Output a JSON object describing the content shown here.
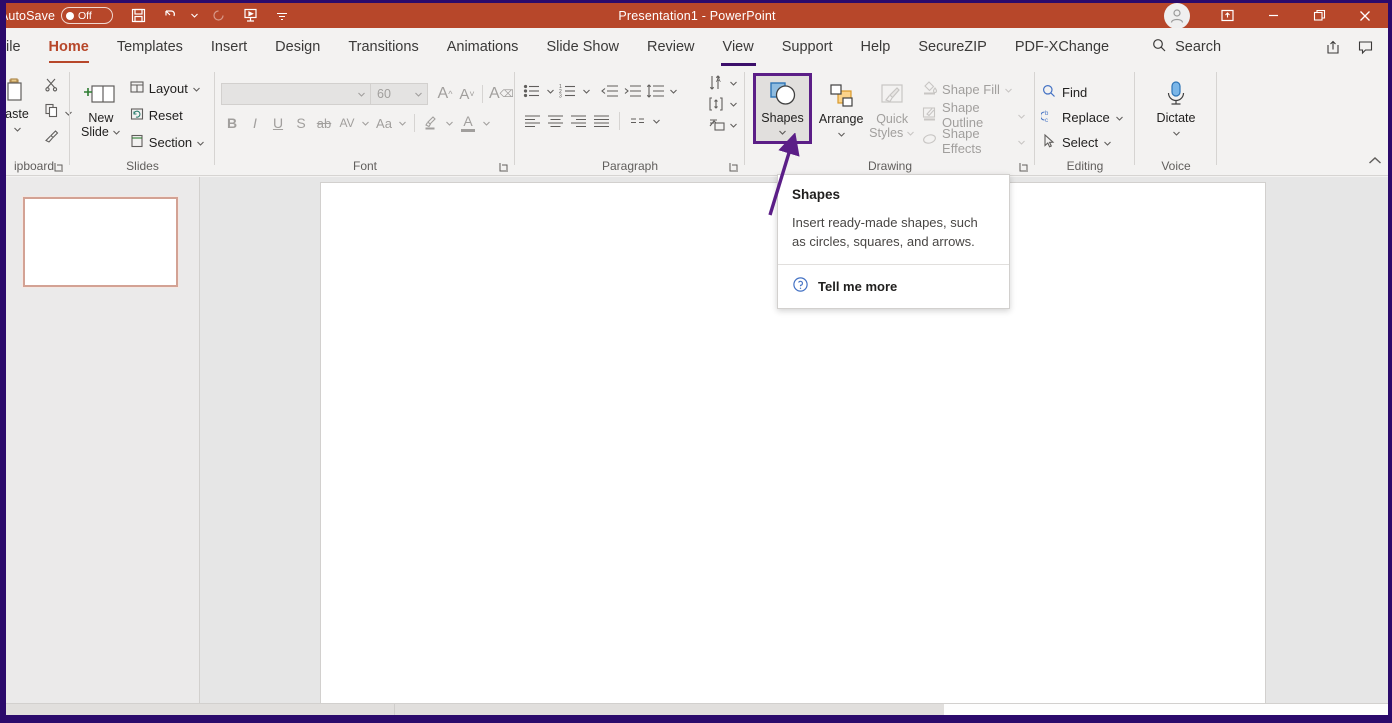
{
  "titlebar": {
    "autosave_label": "AutoSave",
    "autosave_state": "Off",
    "document_title": "Presentation1  -  PowerPoint",
    "quick_access": [
      {
        "name": "save-icon",
        "label": "Save"
      },
      {
        "name": "undo-icon",
        "label": "Undo"
      },
      {
        "name": "undo-dropdown-icon",
        "label": "Undo options"
      },
      {
        "name": "redo-icon",
        "label": "Redo"
      },
      {
        "name": "start-from-beginning-icon",
        "label": "Start From Beginning"
      },
      {
        "name": "customize-qat-icon",
        "label": "Customize Quick Access Toolbar"
      }
    ],
    "window_controls": [
      {
        "name": "ribbon-display-options-icon",
        "label": "Ribbon Display Options"
      },
      {
        "name": "minimize-icon",
        "label": "Minimize"
      },
      {
        "name": "restore-icon",
        "label": "Restore Down"
      },
      {
        "name": "close-icon",
        "label": "Close"
      }
    ],
    "accent_color": "#b7472a"
  },
  "tabs": [
    {
      "label": "ile",
      "name": "tab-file",
      "active": false
    },
    {
      "label": "Home",
      "name": "tab-home",
      "active": true
    },
    {
      "label": "Templates",
      "name": "tab-templates",
      "active": false
    },
    {
      "label": "Insert",
      "name": "tab-insert",
      "active": false
    },
    {
      "label": "Design",
      "name": "tab-design",
      "active": false
    },
    {
      "label": "Transitions",
      "name": "tab-transitions",
      "active": false
    },
    {
      "label": "Animations",
      "name": "tab-animations",
      "active": false
    },
    {
      "label": "Slide Show",
      "name": "tab-slide-show",
      "active": false
    },
    {
      "label": "Review",
      "name": "tab-review",
      "active": false
    },
    {
      "label": "View",
      "name": "tab-view",
      "active": false
    },
    {
      "label": "Support",
      "name": "tab-support",
      "active": false
    },
    {
      "label": "Help",
      "name": "tab-help",
      "active": false
    },
    {
      "label": "SecureZIP",
      "name": "tab-securezip",
      "active": false
    },
    {
      "label": "PDF-XChange",
      "name": "tab-pdf-xchange",
      "active": false
    }
  ],
  "search": {
    "label": "Search"
  },
  "ribbon": {
    "clipboard": {
      "group_label": "ipboard",
      "paste_label": "aste",
      "cut_label": "Cut",
      "copy_label": "Copy",
      "format_painter_label": "Format Painter"
    },
    "slides": {
      "group_label": "Slides",
      "new_slide_line1": "New",
      "new_slide_line2": "Slide",
      "layout_label": "Layout",
      "reset_label": "Reset",
      "section_label": "Section"
    },
    "font": {
      "group_label": "Font",
      "font_name_value": "",
      "font_size_value": "60",
      "increase_size_label": "A",
      "decrease_size_label": "A",
      "clear_formatting_label": "A",
      "bold_label": "B",
      "italic_label": "I",
      "underline_label": "U",
      "shadow_label": "S",
      "strikethrough_label": "ab",
      "char_spacing_label": "AV",
      "change_case_label": "Aa",
      "text_highlight_label": "Text Highlight Color",
      "font_color_label": "A",
      "disabled": true
    },
    "paragraph": {
      "group_label": "Paragraph",
      "buttons": [
        "Bullets",
        "Numbering",
        "Decrease Indent",
        "Increase Indent",
        "Line Spacing",
        "Align Left",
        "Center",
        "Align Right",
        "Justify",
        "Columns",
        "Text Direction",
        "Align Text",
        "Convert to SmartArt"
      ]
    },
    "drawing": {
      "group_label": "Drawing",
      "shapes_label": "Shapes",
      "arrange_label": "Arrange",
      "quick_styles_line1": "Quick",
      "quick_styles_line2": "Styles",
      "shape_fill_label": "Shape Fill",
      "shape_outline_label": "Shape Outline",
      "shape_effects_label": "Shape Effects",
      "highlight_color": "#5b1e87"
    },
    "editing": {
      "group_label": "Editing",
      "find_label": "Find",
      "replace_label": "Replace",
      "select_label": "Select"
    },
    "voice": {
      "group_label": "Voice",
      "dictate_label": "Dictate"
    }
  },
  "tooltip": {
    "title": "Shapes",
    "description": "Insert ready-made shapes, such as circles, squares, and arrows.",
    "link_label": "Tell me more",
    "help_icon": "question-circle-icon"
  },
  "workspace": {
    "thumbnail_selected": true,
    "slide_count": 1
  }
}
